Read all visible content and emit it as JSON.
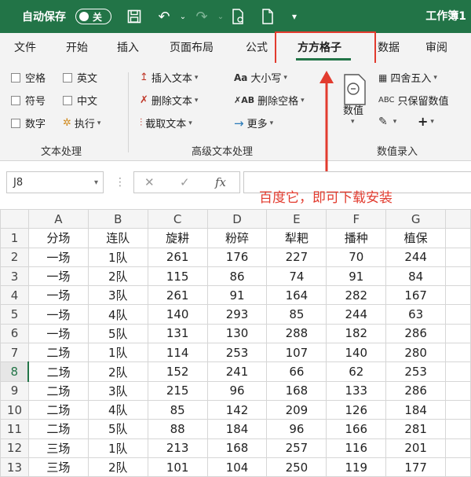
{
  "titlebar": {
    "autosave_label": "自动保存",
    "autosave_state": "关",
    "window_title": "工作簿1"
  },
  "tabs": [
    {
      "label": "文件"
    },
    {
      "label": "开始"
    },
    {
      "label": "插入"
    },
    {
      "label": "页面布局"
    },
    {
      "label": "公式"
    },
    {
      "label": "方方格子"
    },
    {
      "label": "数据"
    },
    {
      "label": "审阅"
    }
  ],
  "ribbon": {
    "text_group": {
      "items": [
        "空格",
        "英文",
        "符号",
        "中文",
        "数字",
        "执行"
      ],
      "label": "文本处理"
    },
    "advanced_group": {
      "items": [
        "插入文本",
        "删除文本",
        "截取文本",
        "大小写",
        "删除空格",
        "更多"
      ],
      "label": "高级文本处理"
    },
    "input_group": {
      "numeric_label": "数值",
      "items": [
        "四舍五入",
        "只保留数值"
      ],
      "label": "数值录入"
    }
  },
  "formula_bar": {
    "name_box": "J8",
    "fx": "fx"
  },
  "annotation": "百度它，即可下载安装",
  "grid": {
    "columns": [
      "A",
      "B",
      "C",
      "D",
      "E",
      "F",
      "G"
    ],
    "selected_row": 8,
    "rows": [
      {
        "num": "1",
        "cells": [
          "分场",
          "连队",
          "旋耕",
          "粉碎",
          "犁耙",
          "播种",
          "植保"
        ]
      },
      {
        "num": "2",
        "cells": [
          "一场",
          "1队",
          "261",
          "176",
          "227",
          "70",
          "244"
        ]
      },
      {
        "num": "3",
        "cells": [
          "一场",
          "2队",
          "115",
          "86",
          "74",
          "91",
          "84"
        ]
      },
      {
        "num": "4",
        "cells": [
          "一场",
          "3队",
          "261",
          "91",
          "164",
          "282",
          "167"
        ]
      },
      {
        "num": "5",
        "cells": [
          "一场",
          "4队",
          "140",
          "293",
          "85",
          "244",
          "63"
        ]
      },
      {
        "num": "6",
        "cells": [
          "一场",
          "5队",
          "131",
          "130",
          "288",
          "182",
          "286"
        ]
      },
      {
        "num": "7",
        "cells": [
          "二场",
          "1队",
          "114",
          "253",
          "107",
          "140",
          "280"
        ]
      },
      {
        "num": "8",
        "cells": [
          "二场",
          "2队",
          "152",
          "241",
          "66",
          "62",
          "253"
        ]
      },
      {
        "num": "9",
        "cells": [
          "二场",
          "3队",
          "215",
          "96",
          "168",
          "133",
          "286"
        ]
      },
      {
        "num": "10",
        "cells": [
          "二场",
          "4队",
          "85",
          "142",
          "209",
          "126",
          "184"
        ]
      },
      {
        "num": "11",
        "cells": [
          "二场",
          "5队",
          "88",
          "184",
          "96",
          "166",
          "281"
        ]
      },
      {
        "num": "12",
        "cells": [
          "三场",
          "1队",
          "213",
          "168",
          "257",
          "116",
          "201"
        ]
      },
      {
        "num": "13",
        "cells": [
          "三场",
          "2队",
          "101",
          "104",
          "250",
          "119",
          "177"
        ]
      }
    ]
  }
}
